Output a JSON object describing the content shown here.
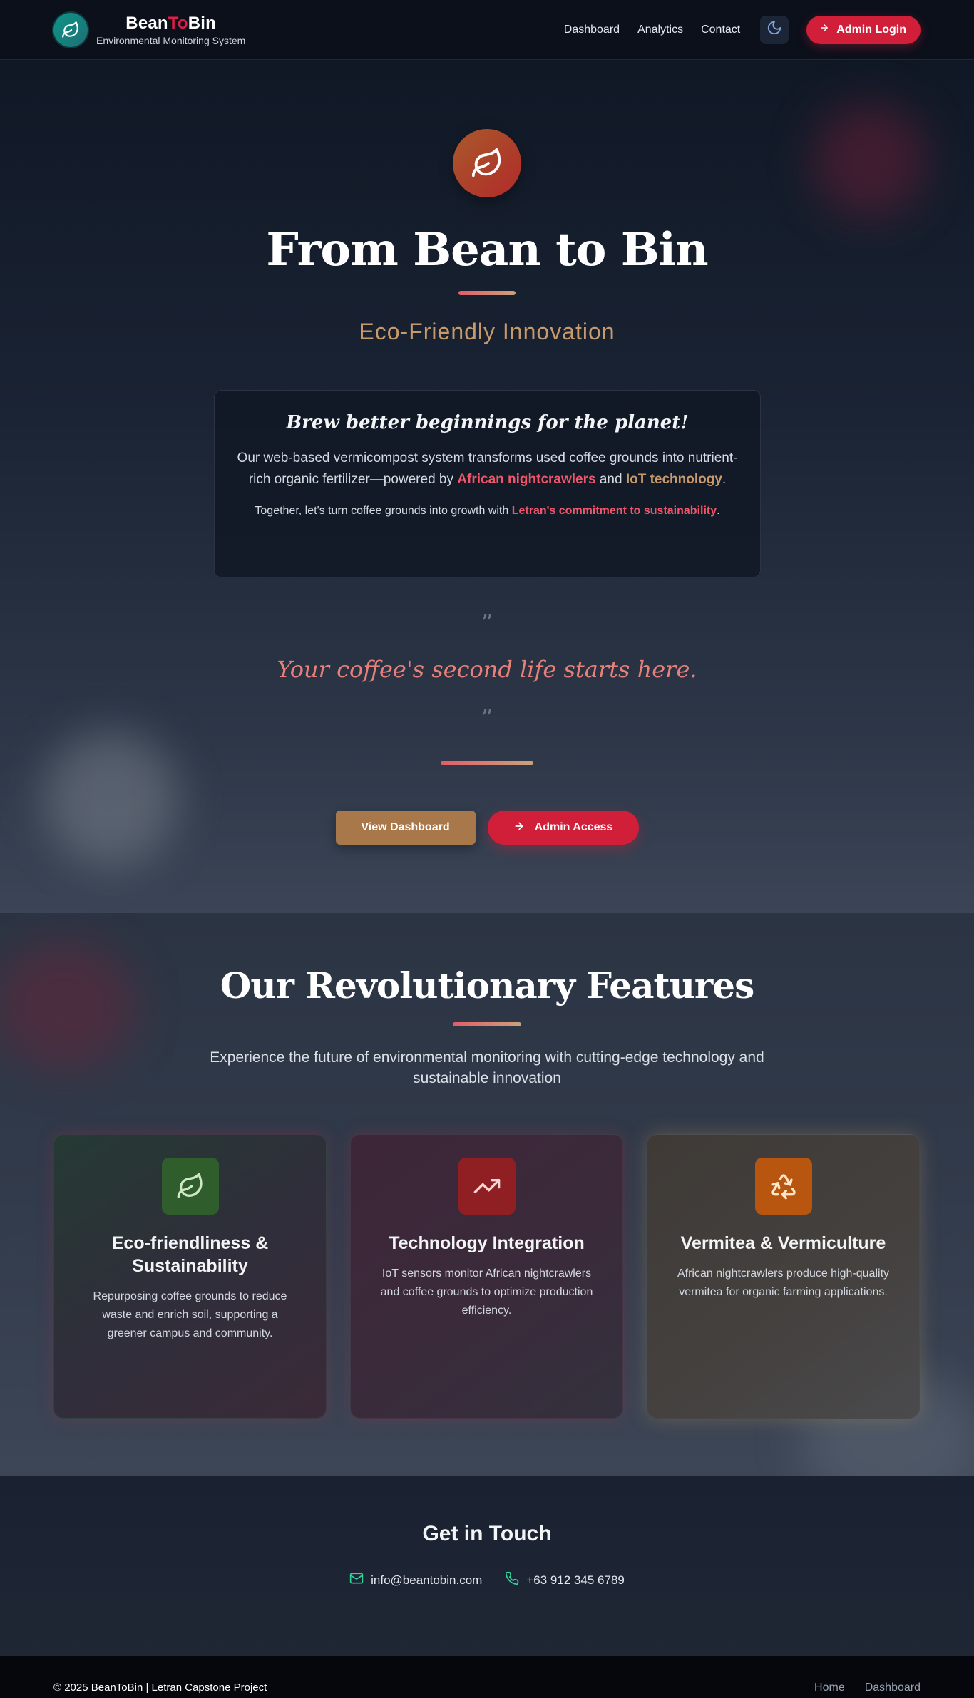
{
  "header": {
    "brand_prefix": "Bean",
    "brand_mid": "To",
    "brand_suffix": "Bin",
    "brand_subtitle": "Environmental Monitoring System",
    "nav": [
      "Dashboard",
      "Analytics",
      "Contact"
    ],
    "login_label": "Admin Login"
  },
  "hero": {
    "title": "From Bean to Bin",
    "subtitle": "Eco-Friendly Innovation",
    "card_heading": "Brew better beginnings for the planet!",
    "card_body_1": "Our web-based vermicompost system transforms used coffee grounds into nutrient-rich organic fertilizer—powered by ",
    "card_hl_1": "African nightcrawlers",
    "card_body_2": " and ",
    "card_hl_2": "IoT technology",
    "card_body_3": ".",
    "card_foot_1": "Together, let's turn coffee grounds into growth with ",
    "card_foot_hl": "Letran's commitment to sustainability",
    "card_foot_2": ".",
    "quote_open": "”",
    "quote": "Your coffee's second life starts here.",
    "quote_close": "”",
    "btn_dashboard": "View Dashboard",
    "btn_admin": "Admin Access"
  },
  "features": {
    "title": "Our Revolutionary Features",
    "subtitle": "Experience the future of environmental monitoring with cutting-edge technology and sustainable innovation",
    "cards": [
      {
        "title": "Eco-friendliness & Sustainability",
        "desc": "Repurposing coffee grounds to reduce waste and enrich soil, supporting a greener campus and community.",
        "icon": "leaf-icon"
      },
      {
        "title": "Technology Integration",
        "desc": "IoT sensors monitor African nightcrawlers and coffee grounds to optimize production efficiency.",
        "icon": "trending-up-icon"
      },
      {
        "title": "Vermitea & Vermiculture",
        "desc": "African nightcrawlers produce high-quality vermitea for organic farming applications.",
        "icon": "recycle-icon"
      }
    ]
  },
  "contact": {
    "title": "Get in Touch",
    "email": "info@beantobin.com",
    "phone": "+63 912 345 6789"
  },
  "footer": {
    "copyright": "© 2025 BeanToBin | Letran Capstone Project",
    "links": [
      "Home",
      "Dashboard"
    ]
  },
  "colors": {
    "accent_red": "#d11f3a",
    "accent_tan": "#a8784b",
    "teal_logo": "#0d9488"
  }
}
